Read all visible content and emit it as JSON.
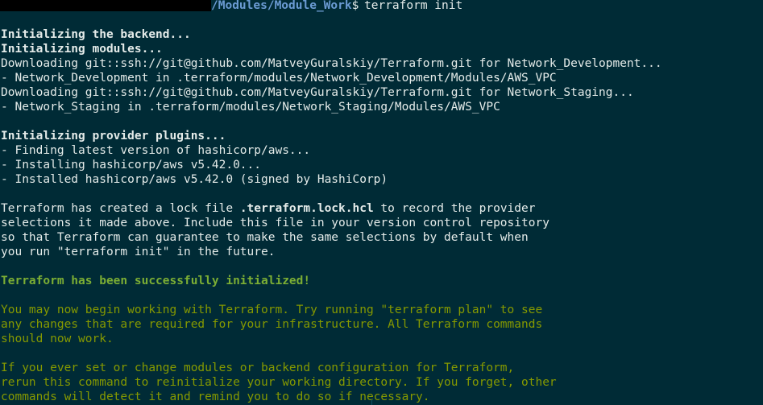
{
  "prompt": {
    "path": "/Modules/Module_Work",
    "symbol": "$",
    "command": "terraform init"
  },
  "backend": {
    "initializing": "Initializing the backend..."
  },
  "modules": {
    "heading": "Initializing modules...",
    "download_dev": "Downloading git::ssh://git@github.com/MatveyGuralskiy/Terraform.git for Network_Development...",
    "dev_path": "- Network_Development in .terraform/modules/Network_Development/Modules/AWS_VPC",
    "download_staging": "Downloading git::ssh://git@github.com/MatveyGuralskiy/Terraform.git for Network_Staging...",
    "staging_path": "- Network_Staging in .terraform/modules/Network_Staging/Modules/AWS_VPC"
  },
  "providers": {
    "heading": "Initializing provider plugins...",
    "finding": "- Finding latest version of hashicorp/aws...",
    "installing": "- Installing hashicorp/aws v5.42.0...",
    "installed": "- Installed hashicorp/aws v5.42.0 (signed by HashiCorp)"
  },
  "lockfile": {
    "line1_pre": "Terraform has created a lock file ",
    "filename": ".terraform.lock.hcl",
    "line1_post": " to record the provider",
    "line2": "selections it made above. Include this file in your version control repository",
    "line3": "so that Terraform can guarantee to make the same selections by default when",
    "line4": "you run \"terraform init\" in the future."
  },
  "success": {
    "message": "Terraform has been successfully initialized!"
  },
  "next_steps": {
    "line1": "You may now begin working with Terraform. Try running \"terraform plan\" to see",
    "line2": "any changes that are required for your infrastructure. All Terraform commands",
    "line3": "should now work."
  },
  "reinit": {
    "line1": "If you ever set or change modules or backend configuration for Terraform,",
    "line2": "rerun this command to reinitialize your working directory. If you forget, other",
    "line3": "commands will detect it and remind you to do so if necessary."
  },
  "colors": {
    "background": "#002b36",
    "foreground": "#e4ebe9",
    "path": "#6b9bd3",
    "success": "#7cae34",
    "info": "#859900"
  }
}
